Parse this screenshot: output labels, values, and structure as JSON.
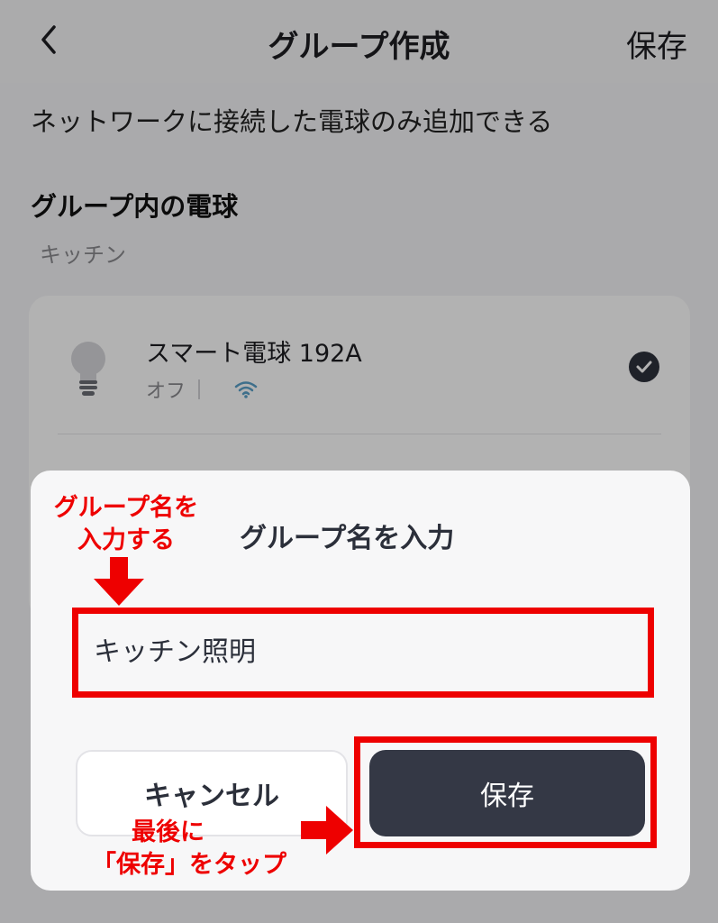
{
  "header": {
    "title": "グループ作成",
    "save_label": "保存"
  },
  "page": {
    "subtitle": "ネットワークに接続した電球のみ追加できる",
    "section_title": "グループ内の電球",
    "room": "キッチン"
  },
  "device": {
    "name": "スマート電球 192A",
    "status": "オフ",
    "icons": [
      "bulb-icon",
      "wifi-icon",
      "check-icon"
    ]
  },
  "dialog": {
    "title": "グループ名を入力",
    "input_value": "キッチン照明",
    "cancel_label": "キャンセル",
    "save_label": "保存"
  },
  "annotations": {
    "top_line1": "グループ名を",
    "top_line2": "入力する",
    "bottom_line1": "最後に",
    "bottom_line2": "「保存」をタップ",
    "color": "#ee0000"
  }
}
